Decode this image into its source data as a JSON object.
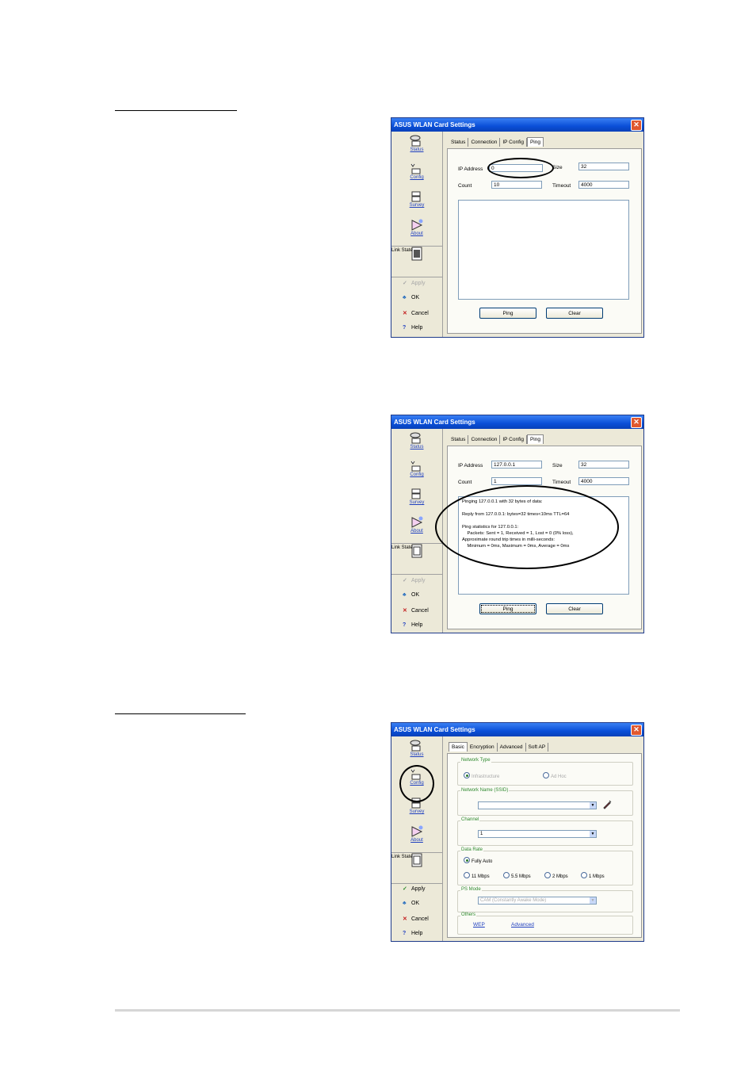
{
  "windows": {
    "w1": {
      "title": "ASUS WLAN Card Settings",
      "close": "✕",
      "nav": {
        "status": "Status",
        "config": "Config",
        "survey": "Survey",
        "about": "About",
        "link_state": "Link State"
      },
      "actions": {
        "apply": "Apply",
        "ok": "OK",
        "cancel": "Cancel",
        "help": "Help"
      },
      "tabs": [
        "Status",
        "Connection",
        "IP Config",
        "Ping"
      ],
      "ip_label": "IP Address",
      "ip_value": "0",
      "size_label": "Size",
      "size_value": "32",
      "count_label": "Count",
      "count_value": "10",
      "timeout_label": "Timeout",
      "timeout_value": "4000",
      "output": "",
      "ping_button": "Ping",
      "clear_button": "Clear"
    },
    "w2": {
      "title": "ASUS WLAN Card Settings",
      "close": "✕",
      "nav": {
        "status": "Status",
        "config": "Config",
        "survey": "Survey",
        "about": "About",
        "link_state": "Link State"
      },
      "actions": {
        "apply": "Apply",
        "ok": "OK",
        "cancel": "Cancel",
        "help": "Help"
      },
      "tabs": [
        "Status",
        "Connection",
        "IP Config",
        "Ping"
      ],
      "ip_label": "IP Address",
      "ip_value": "127.0.0.1",
      "size_label": "Size",
      "size_value": "32",
      "count_label": "Count",
      "count_value": "1",
      "timeout_label": "Timeout",
      "timeout_value": "4000",
      "output": "Pinging 127.0.0.1 with 32 bytes of data:\n\nReply from 127.0.0.1: bytes=32 times<10ms TTL=64\n\nPing statistics for 127.0.0.1:\n    Packets: Sent = 1, Received = 1, Lost = 0 (0% loss),\nApproximate round trip times in milli-seconds:\n    Minimum = 0ms, Maximum = 0ms, Average = 0ms",
      "ping_button": "Ping",
      "clear_button": "Clear"
    },
    "w3": {
      "title": "ASUS WLAN Card Settings",
      "close": "✕",
      "nav": {
        "status": "Status",
        "config": "Config",
        "survey": "Survey",
        "about": "About",
        "link_state": "Link State"
      },
      "actions": {
        "apply": "Apply",
        "ok": "OK",
        "cancel": "Cancel",
        "help": "Help"
      },
      "tabs": [
        "Basic",
        "Encryption",
        "Advanced",
        "Soft AP"
      ],
      "network_type": "Network Type",
      "infrastructure": "Infrastructure",
      "adhoc": "Ad Hoc",
      "network_name": "Network Name (SSID)",
      "ssid_value": "",
      "channel": "Channel",
      "channel_value": "1",
      "data_rate": "Data Rate",
      "fully_auto": "Fully Auto",
      "rates": [
        "11 Mbps",
        "5.5 Mbps",
        "2 Mbps",
        "1 Mbps"
      ],
      "ps_mode": "PS Mode",
      "ps_value": "CAM (Constantly Awake Mode)",
      "others": "Others",
      "wep": "WEP",
      "advanced": "Advanced"
    }
  }
}
